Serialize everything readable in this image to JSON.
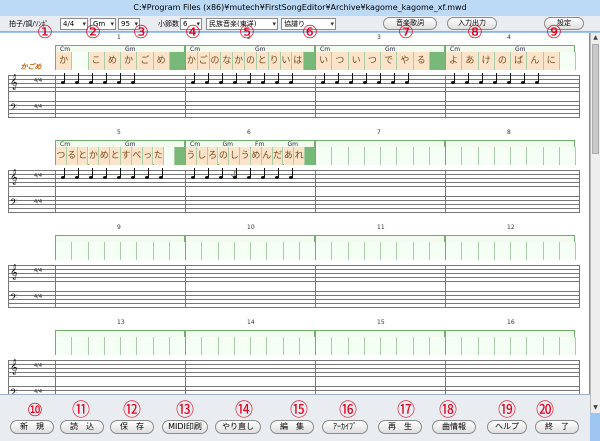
{
  "window": {
    "title": "C:¥Program Files (x86)¥mutech¥FirstSongEditor¥Archive¥kagome_kagome_xf.mwd"
  },
  "toolbar": {
    "label_time_key_tempo": "拍子/調/ｿﾝﾎﾟ",
    "time_signature": "4/4",
    "key": "Gm",
    "tempo": "95",
    "label_measures": "小節数",
    "measures": "6",
    "genre": "民族音楽(東洋)",
    "mode": "協譜り",
    "lyric_button": "音楽歌詞",
    "input_button": "入力出力",
    "settings_button": "設定"
  },
  "markers": [
    "①",
    "②",
    "③",
    "④",
    "⑤",
    "⑥",
    "⑦",
    "⑧",
    "⑨",
    "⑩",
    "⑪",
    "⑫",
    "⑬",
    "⑭",
    "⑮",
    "⑯",
    "⑰",
    "⑱",
    "⑲",
    "⑳"
  ],
  "systems": [
    {
      "measures": [
        {
          "number": "1",
          "chords": [
            "Cm",
            "Gm"
          ],
          "cells": [
            {
              "t": "か",
              "k": "lyr"
            },
            {
              "t": "",
              "k": ""
            },
            {
              "t": "こ",
              "k": "lyr"
            },
            {
              "t": "め",
              "k": "lyr"
            },
            {
              "t": "か",
              "k": "lyr"
            },
            {
              "t": "ご",
              "k": "lyr"
            },
            {
              "t": "め",
              "k": "lyr"
            },
            {
              "t": "",
              "k": "end"
            }
          ]
        },
        {
          "number": "2",
          "chords": [
            "Cm",
            "Gm"
          ],
          "cells": [
            {
              "t": "か",
              "k": "lyr"
            },
            {
              "t": "ご",
              "k": "lyr"
            },
            {
              "t": "の",
              "k": "lyr"
            },
            {
              "t": "な",
              "k": "lyr"
            },
            {
              "t": "か",
              "k": "lyr"
            },
            {
              "t": "の",
              "k": "lyr"
            },
            {
              "t": "と",
              "k": "lyr"
            },
            {
              "t": "り",
              "k": "lyr"
            },
            {
              "t": "い",
              "k": "lyr"
            },
            {
              "t": "は",
              "k": "lyr"
            },
            {
              "t": "",
              "k": "end"
            }
          ]
        },
        {
          "number": "3",
          "chords": [
            "Cm",
            "Gm"
          ],
          "cells": [
            {
              "t": "い",
              "k": "lyr"
            },
            {
              "t": "つ",
              "k": "lyr"
            },
            {
              "t": "い",
              "k": "lyr"
            },
            {
              "t": "つ",
              "k": "lyr"
            },
            {
              "t": "で",
              "k": "lyr"
            },
            {
              "t": "や",
              "k": "lyr"
            },
            {
              "t": "る",
              "k": "lyr"
            },
            {
              "t": "",
              "k": "end"
            }
          ]
        },
        {
          "number": "4",
          "chords": [
            "Cm",
            "Gm"
          ],
          "cells": [
            {
              "t": "よ",
              "k": "lyr"
            },
            {
              "t": "あ",
              "k": "lyr"
            },
            {
              "t": "け",
              "k": "lyr"
            },
            {
              "t": "の",
              "k": "lyr"
            },
            {
              "t": "ば",
              "k": "lyr"
            },
            {
              "t": "ん",
              "k": "lyr"
            },
            {
              "t": "に",
              "k": "lyr"
            },
            {
              "t": "",
              "k": ""
            }
          ]
        }
      ]
    },
    {
      "measures": [
        {
          "number": "5",
          "chords": [
            "Cm",
            "Gm"
          ],
          "cells": [
            {
              "t": "つ",
              "k": "lyr"
            },
            {
              "t": "る",
              "k": "lyr"
            },
            {
              "t": "と",
              "k": "lyr"
            },
            {
              "t": "か",
              "k": "lyr"
            },
            {
              "t": "め",
              "k": "lyr"
            },
            {
              "t": "と",
              "k": "lyr"
            },
            {
              "t": "す",
              "k": "lyr"
            },
            {
              "t": "べ",
              "k": "lyr"
            },
            {
              "t": "っ",
              "k": "lyr"
            },
            {
              "t": "た",
              "k": "lyr"
            },
            {
              "t": "",
              "k": ""
            },
            {
              "t": "",
              "k": "end"
            }
          ]
        },
        {
          "number": "6",
          "chords": [
            "Cm",
            "Gm",
            "Fm",
            "Gm"
          ],
          "cells": [
            {
              "t": "う",
              "k": "lyr"
            },
            {
              "t": "し",
              "k": "lyr"
            },
            {
              "t": "ろ",
              "k": "lyr"
            },
            {
              "t": "の",
              "k": "lyr"
            },
            {
              "t": "しょ",
              "k": "lyr"
            },
            {
              "t": "う",
              "k": "lyr"
            },
            {
              "t": "め",
              "k": "lyr"
            },
            {
              "t": "ん",
              "k": "lyr"
            },
            {
              "t": "だ",
              "k": "lyr"
            },
            {
              "t": "あ",
              "k": "lyr"
            },
            {
              "t": "れ",
              "k": "lyr"
            },
            {
              "t": "",
              "k": "end"
            }
          ]
        },
        {
          "number": "7",
          "chords": [],
          "cells": []
        },
        {
          "number": "8",
          "chords": [],
          "cells": []
        }
      ]
    },
    {
      "measures": [
        {
          "number": "9",
          "chords": [],
          "cells": []
        },
        {
          "number": "10",
          "chords": [],
          "cells": []
        },
        {
          "number": "11",
          "chords": [],
          "cells": []
        },
        {
          "number": "12",
          "chords": [],
          "cells": []
        }
      ]
    },
    {
      "measures": [
        {
          "number": "13",
          "chords": [],
          "cells": []
        },
        {
          "number": "14",
          "chords": [],
          "cells": []
        },
        {
          "number": "15",
          "chords": [],
          "cells": []
        },
        {
          "number": "16",
          "chords": [],
          "cells": []
        }
      ]
    }
  ],
  "bottom": {
    "buttons": [
      "新　規",
      "読　込",
      "保　存",
      "MIDI印刷",
      "やり直し",
      "編　集",
      "ｱｰｶｲﾌﾞ",
      "再　生",
      "曲情報",
      "ヘルプ",
      "終　了"
    ]
  },
  "logo_text": "かごめ",
  "clef_treble": "𝄞",
  "clef_bass": "𝄢",
  "time_sig": "4/4"
}
